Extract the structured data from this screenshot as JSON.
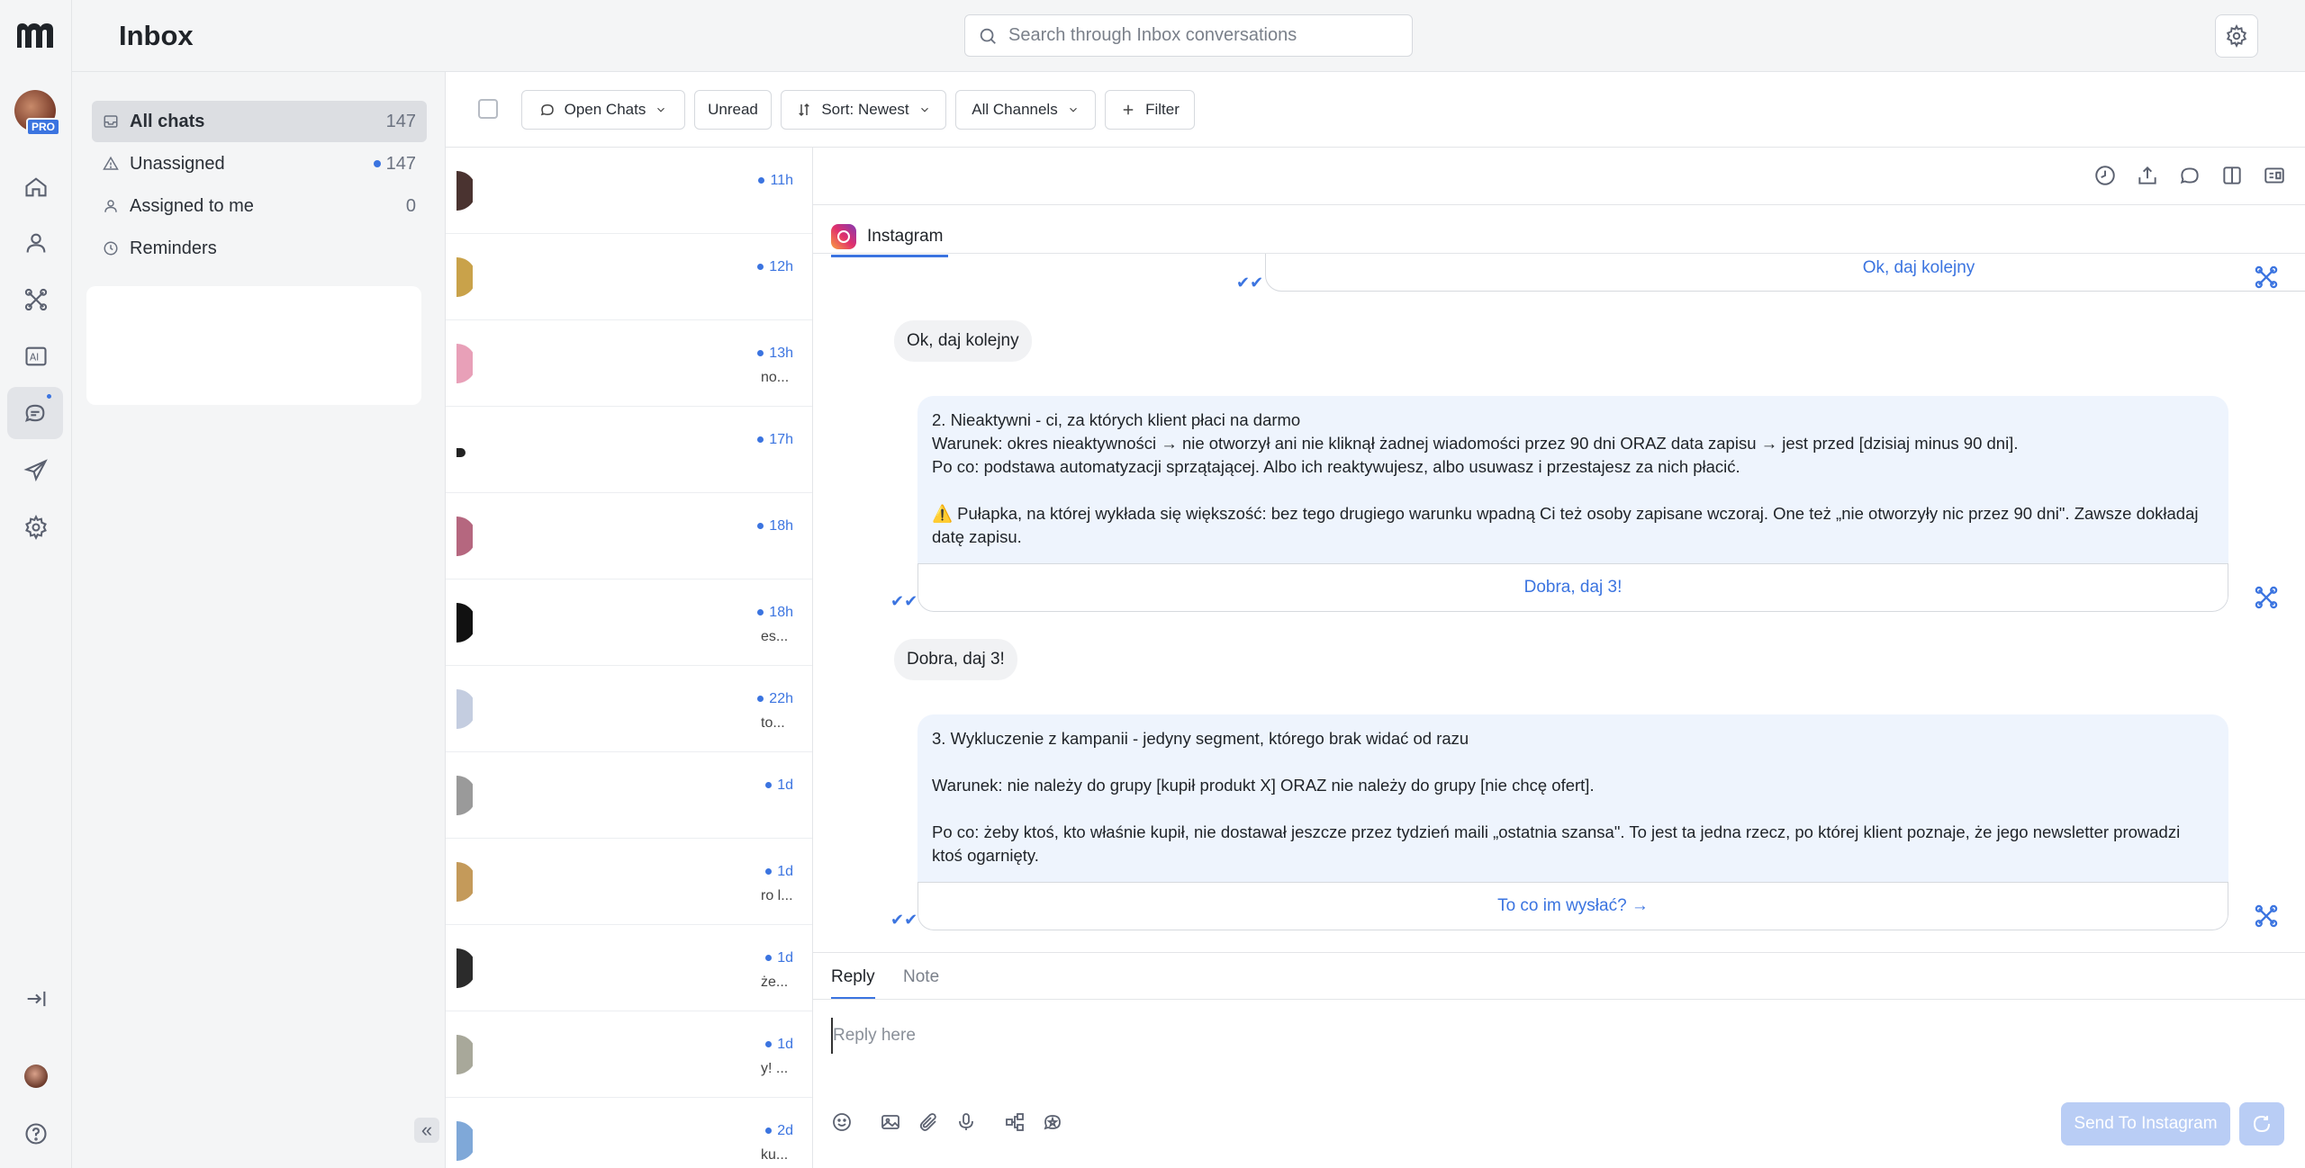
{
  "app": {
    "title": "Inbox",
    "pro_badge": "PRO"
  },
  "search": {
    "placeholder": "Search through Inbox conversations"
  },
  "folders": [
    {
      "label": "All chats",
      "count": "147",
      "icon": "inbox-icon"
    },
    {
      "label": "Unassigned",
      "count": "147",
      "icon": "warning-icon"
    },
    {
      "label": "Assigned to me",
      "count": "0",
      "icon": "person-icon"
    },
    {
      "label": "Reminders",
      "count": "",
      "icon": "clock-icon"
    }
  ],
  "filters": {
    "open_chats": "Open Chats",
    "unread": "Unread",
    "sort": "Sort: Newest",
    "channels": "All Channels",
    "filter": "Filter"
  },
  "conversations": [
    {
      "time": "11h",
      "snippet": "",
      "thumb": "#4a3330"
    },
    {
      "time": "12h",
      "snippet": "",
      "thumb": "#c9a24a"
    },
    {
      "time": "13h",
      "snippet": "no...",
      "thumb": "#e8a0b8"
    },
    {
      "time": "17h",
      "snippet": "",
      "thumb": "#222222"
    },
    {
      "time": "18h",
      "snippet": "",
      "thumb": "#b5677f"
    },
    {
      "time": "18h",
      "snippet": "es...",
      "thumb": "#111111"
    },
    {
      "time": "22h",
      "snippet": "to...",
      "thumb": "#c4cde0"
    },
    {
      "time": "1d",
      "snippet": "",
      "thumb": "#9a9a9a"
    },
    {
      "time": "1d",
      "snippet": "ro l...",
      "thumb": "#c49a5a"
    },
    {
      "time": "1d",
      "snippet": "że...",
      "thumb": "#2b2b2b"
    },
    {
      "time": "1d",
      "snippet": "y! ...",
      "thumb": "#a8a89a"
    },
    {
      "time": "2d",
      "snippet": "ku...",
      "thumb": "#7fa8d8"
    }
  ],
  "chat": {
    "channel": "Instagram",
    "messages": {
      "top_quick_reply": "Ok, daj kolejny",
      "incoming_1": "Ok, daj kolejny",
      "bot_1": "2. Nieaktywni - ci, za których klient płaci na darmo\nWarunek: okres nieaktywności → nie otworzył ani nie kliknął żadnej wiadomości przez 90 dni ORAZ data zapisu → jest przed [dzisiaj minus 90 dni].\nPo co: podstawa automatyzacji sprzątającej. Albo ich reaktywujesz, albo usuwasz i przestajesz za nich płacić.\n\n⚠️ Pułapka, na której wykłada się większość: bez tego drugiego warunku wpadną Ci też osoby zapisane wczoraj. One też „nie otworzyły nic przez 90 dni\". Zawsze dokładaj datę zapisu.",
      "bot_1_quick_reply": "Dobra, daj 3!",
      "incoming_2": "Dobra, daj 3!",
      "bot_2": "3. Wykluczenie z kampanii - jedyny segment, którego brak widać od razu\n\nWarunek: nie należy do grupy [kupił produkt X] ORAZ nie należy do grupy [nie chcę ofert].\n\nPo co: żeby ktoś, kto właśnie kupił, nie dostawał jeszcze przez tydzień maili „ostatnia szansa\". To jest ta jedna rzecz, po której klient poznaje, że jego newsletter prowadzi ktoś ogarnięty.",
      "bot_2_quick_reply": "To co im wysłać? →"
    },
    "composer": {
      "tab_reply": "Reply",
      "tab_note": "Note",
      "placeholder": "Reply here",
      "send_label": "Send To Instagram"
    }
  },
  "colors": {
    "accent": "#3b74e0",
    "bot_bubble": "#eef4fd",
    "rail_bg": "#f4f5f6"
  }
}
